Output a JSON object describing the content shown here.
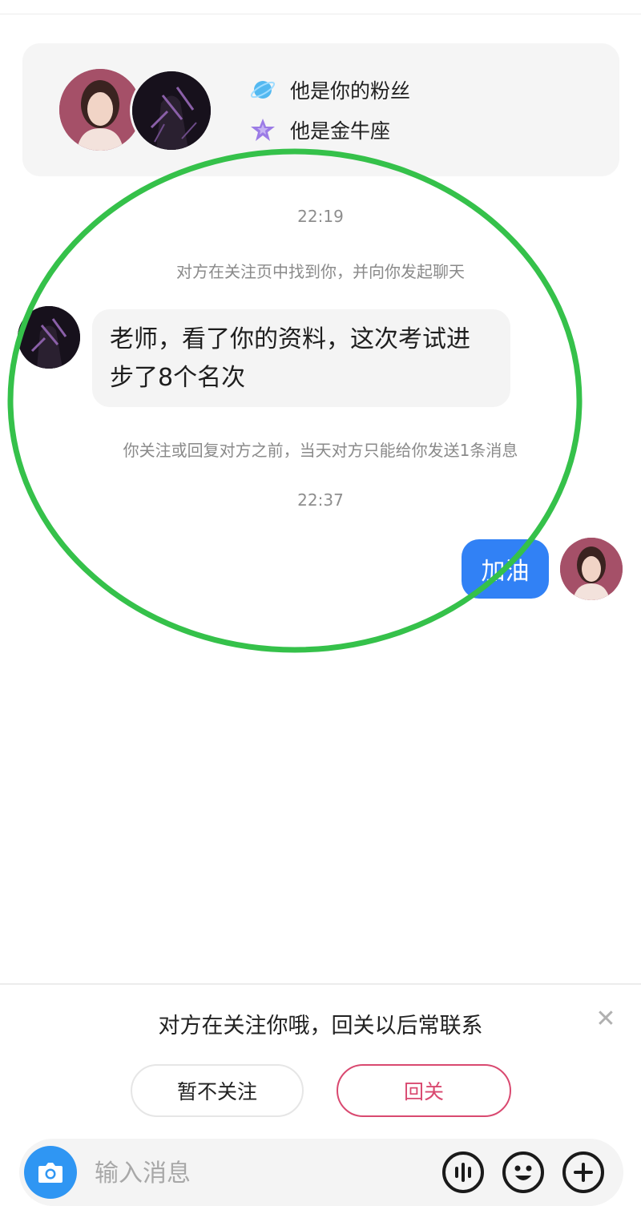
{
  "profile": {
    "tags": [
      {
        "icon": "planet-icon",
        "text": "他是你的粉丝"
      },
      {
        "icon": "star-icon",
        "text": "他是金牛座"
      }
    ]
  },
  "chat": {
    "time_1": "22:19",
    "system_1": "对方在关注页中找到你，并向你发起聊天",
    "incoming_message": [
      "老师，看了你的资料，这次考试进",
      "步了8个名次"
    ],
    "system_2": "你关注或回复对方之前，当天对方只能给你发送1条消息",
    "time_2": "22:37",
    "outgoing_message": "加油"
  },
  "follow_prompt": {
    "text": "对方在关注你哦，回关以后常联系",
    "close_icon": "close-icon",
    "skip_label": "暂不关注",
    "follow_label": "回关"
  },
  "input_bar": {
    "placeholder": "输入消息",
    "icons": [
      "camera-icon",
      "voice-icon",
      "emoji-icon",
      "plus-icon"
    ]
  },
  "colors": {
    "accent_blue": "#3181f5",
    "follow_pink": "#d94970",
    "annotation_green": "#35c14a"
  }
}
